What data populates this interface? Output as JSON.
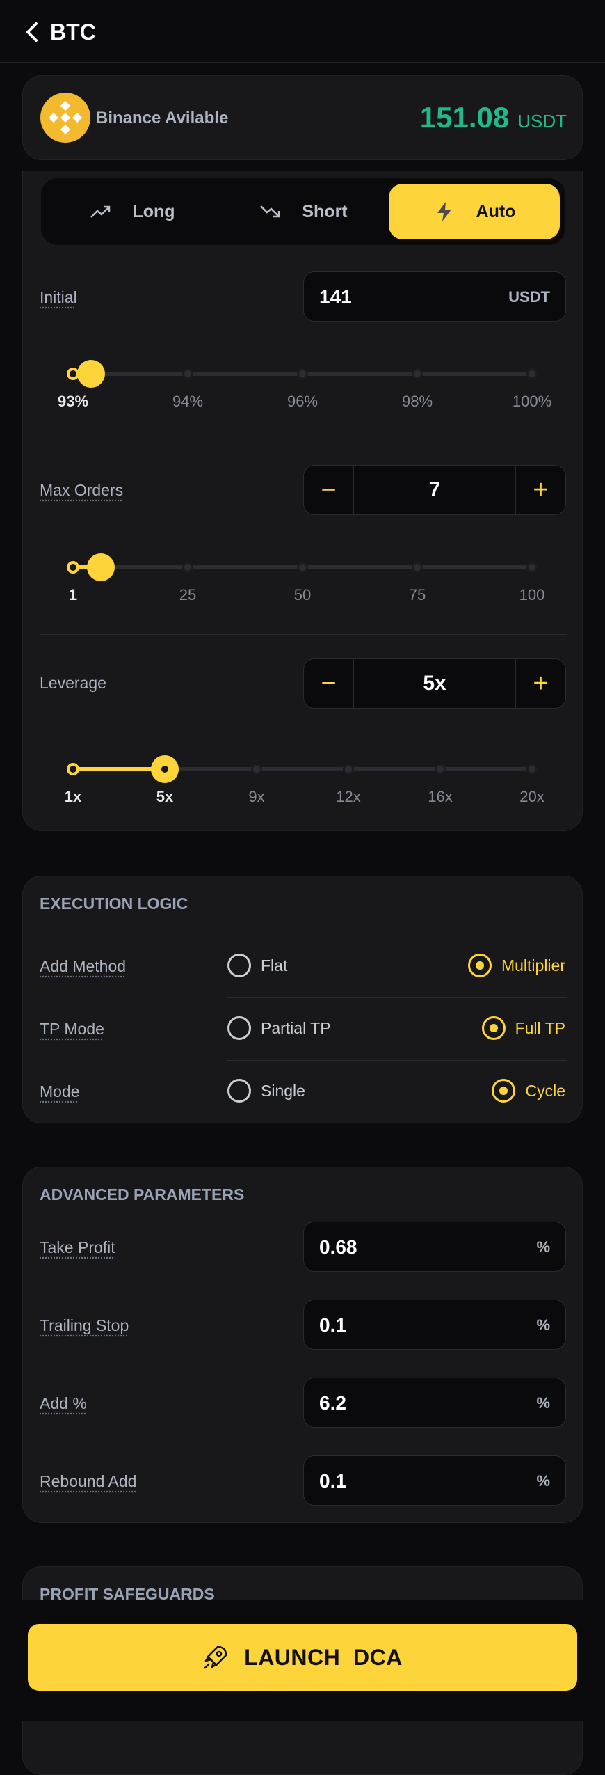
{
  "header": {
    "title": "BTC",
    "back_icon": "chevron-left-icon"
  },
  "balance": {
    "label": "Binance Avilable",
    "value": "151.08",
    "unit": "USDT",
    "logo_icon": "binance-logo-icon"
  },
  "direction": {
    "options": [
      {
        "label": "Long",
        "icon": "trending-up-icon"
      },
      {
        "label": "Short",
        "icon": "trending-down-icon"
      },
      {
        "label": "Auto",
        "icon": "lightning-icon"
      }
    ],
    "selected": "Auto"
  },
  "initial": {
    "label": "Initial",
    "value": "141",
    "unit": "USDT",
    "slider": {
      "ticks": [
        "93%",
        "94%",
        "96%",
        "98%",
        "100%"
      ],
      "value_fraction": 0.04
    }
  },
  "max_orders": {
    "label": "Max Orders",
    "value": "7",
    "minus": "−",
    "plus": "+",
    "slider": {
      "ticks": [
        "1",
        "25",
        "50",
        "75",
        "100"
      ],
      "value_fraction": 0.06
    }
  },
  "leverage": {
    "label": "Leverage",
    "value": "5x",
    "minus": "−",
    "plus": "+",
    "slider": {
      "ticks": [
        "1x",
        "5x",
        "9x",
        "12x",
        "16x",
        "20x"
      ],
      "value_fraction": 0.2
    }
  },
  "execution": {
    "title": "EXECUTION LOGIC",
    "rows": [
      {
        "label": "Add Method",
        "option_a": "Flat",
        "option_b": "Multiplier",
        "selected": "Multiplier"
      },
      {
        "label": "TP Mode",
        "option_a": "Partial TP",
        "option_b": "Full TP",
        "selected": "Full TP"
      },
      {
        "label": "Mode",
        "option_a": "Single",
        "option_b": "Cycle",
        "selected": "Cycle"
      }
    ]
  },
  "advanced": {
    "title": "ADVANCED PARAMETERS",
    "fields": [
      {
        "label": "Take Profit",
        "value": "0.68",
        "unit": "%"
      },
      {
        "label": "Trailing Stop",
        "value": "0.1",
        "unit": "%"
      },
      {
        "label": "Add %",
        "value": "6.2",
        "unit": "%"
      },
      {
        "label": "Rebound Add",
        "value": "0.1",
        "unit": "%"
      }
    ]
  },
  "safeguards": {
    "title": "PROFIT SAFEGUARDS"
  },
  "launch": {
    "label": "LAUNCH  DCA",
    "icon": "rocket-icon"
  },
  "colors": {
    "accent": "#fdd43a",
    "positive": "#1fba8a",
    "background": "#0b0b0d",
    "card": "#18181b"
  }
}
